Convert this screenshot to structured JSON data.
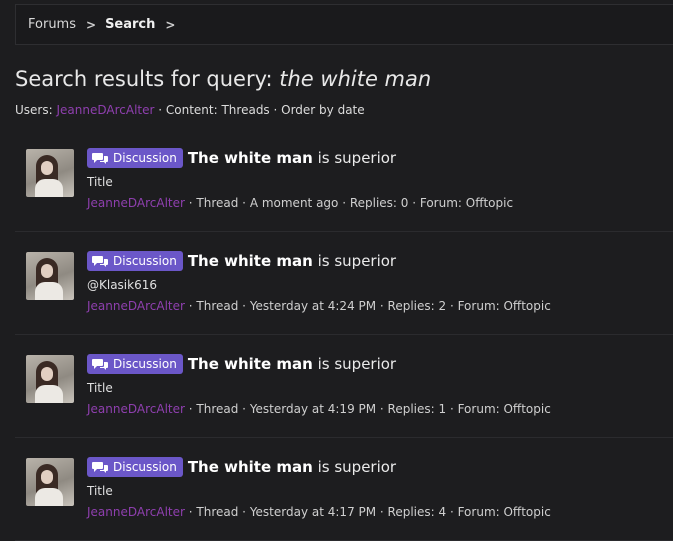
{
  "breadcrumb": {
    "items": [
      "Forums",
      "Search"
    ]
  },
  "search": {
    "title_prefix": "Search results for query:",
    "query": "the white man",
    "users_label": "Users:",
    "user": "JeanneDArcAlter",
    "content": "· Content: Threads · Order by date"
  },
  "results": [
    {
      "badge": "Discussion",
      "title_bold": "The white man",
      "title_rest": "is superior",
      "snippet": "Title",
      "author": "JeanneDArcAlter",
      "details": "· Thread · A moment ago · Replies: 0 · Forum: Offtopic"
    },
    {
      "badge": "Discussion",
      "title_bold": "The white man",
      "title_rest": "is superior",
      "snippet": "@Klasik616",
      "author": "JeanneDArcAlter",
      "details": "· Thread · Yesterday at 4:24 PM · Replies: 2 · Forum: Offtopic"
    },
    {
      "badge": "Discussion",
      "title_bold": "The white man",
      "title_rest": "is superior",
      "snippet": "Title",
      "author": "JeanneDArcAlter",
      "details": "· Thread · Yesterday at 4:19 PM · Replies: 1 · Forum: Offtopic"
    },
    {
      "badge": "Discussion",
      "title_bold": "The white man",
      "title_rest": "is superior",
      "snippet": "Title",
      "author": "JeanneDArcAlter",
      "details": "· Thread · Yesterday at 4:17 PM · Replies: 4 · Forum: Offtopic"
    }
  ],
  "icons": {
    "badge": "chat-bubbles-icon",
    "separator": "chevron-right-icon"
  },
  "colors": {
    "accent": "#6b57c8",
    "username": "#8e3fae"
  }
}
